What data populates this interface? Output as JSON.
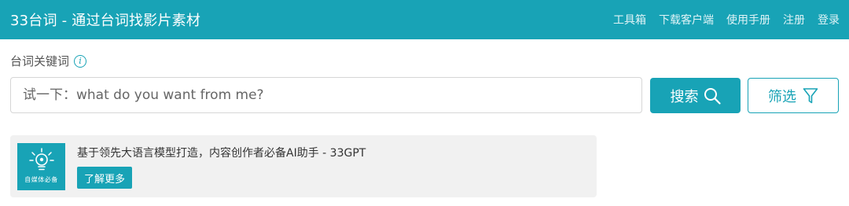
{
  "header": {
    "brand": "33台词 - 通过台词找影片素材",
    "nav": [
      "工具箱",
      "下载客户端",
      "使用手册",
      "注册",
      "登录"
    ]
  },
  "search": {
    "keyword_label": "台词关键词",
    "info_icon": "info-icon",
    "placeholder": "试一下：what do you want from me?",
    "search_label": "搜索",
    "filter_label": "筛选"
  },
  "ad": {
    "logo_caption": "自媒体必备",
    "title": "基于领先大语言模型打造，内容创作者必备AI助手 - 33GPT",
    "button_label": "了解更多"
  },
  "colors": {
    "accent": "#18a3b6",
    "card_bg": "#f1f1f1"
  }
}
